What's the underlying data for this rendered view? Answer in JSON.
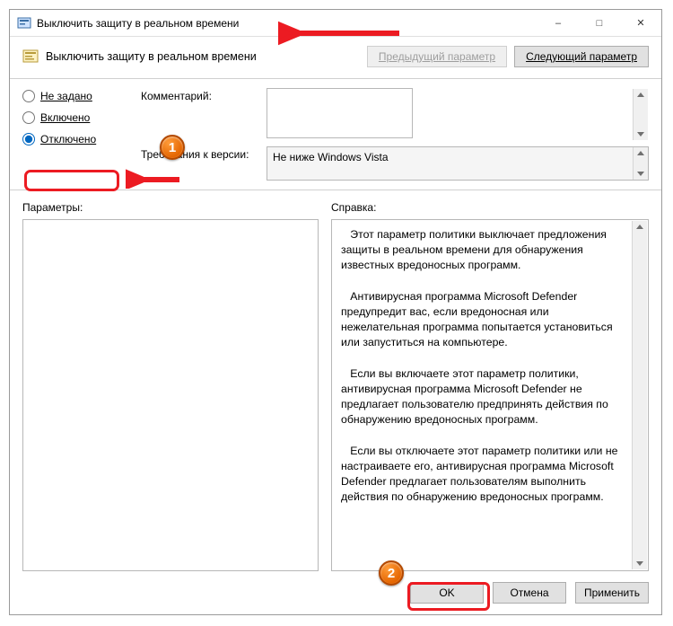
{
  "window": {
    "title": "Выключить защиту в реальном времени"
  },
  "header": {
    "policy_title": "Выключить защиту в реальном времени",
    "prev_btn": "Предыдущий параметр",
    "next_btn": "Следующий параметр"
  },
  "radios": {
    "not_configured": "Не задано",
    "enabled": "Включено",
    "disabled": "Отключено",
    "selected": "disabled"
  },
  "labels": {
    "comment": "Комментарий:",
    "requirements": "Требования к версии:",
    "options": "Параметры:",
    "help": "Справка:"
  },
  "requirements_text": "Не ниже Windows Vista",
  "comment_text": "",
  "help_text": "   Этот параметр политики выключает предложения защиты в реальном времени для обнаружения известных вредоносных программ.\n\n   Антивирусная программа Microsoft Defender предупредит вас, если вредоносная или нежелательная программа попытается установиться или запуститься на компьютере.\n\n   Если вы включаете этот параметр политики, антивирусная программа Microsoft Defender не предлагает пользователю предпринять действия по обнаружению вредоносных программ.\n\n   Если вы отключаете этот параметр политики или не настраиваете его, антивирусная программа Microsoft Defender предлагает пользователям выполнить действия по обнаружению вредоносных программ.",
  "buttons": {
    "ok": "OK",
    "cancel": "Отмена",
    "apply": "Применить"
  },
  "annotations": {
    "badge1": "1",
    "badge2": "2"
  }
}
